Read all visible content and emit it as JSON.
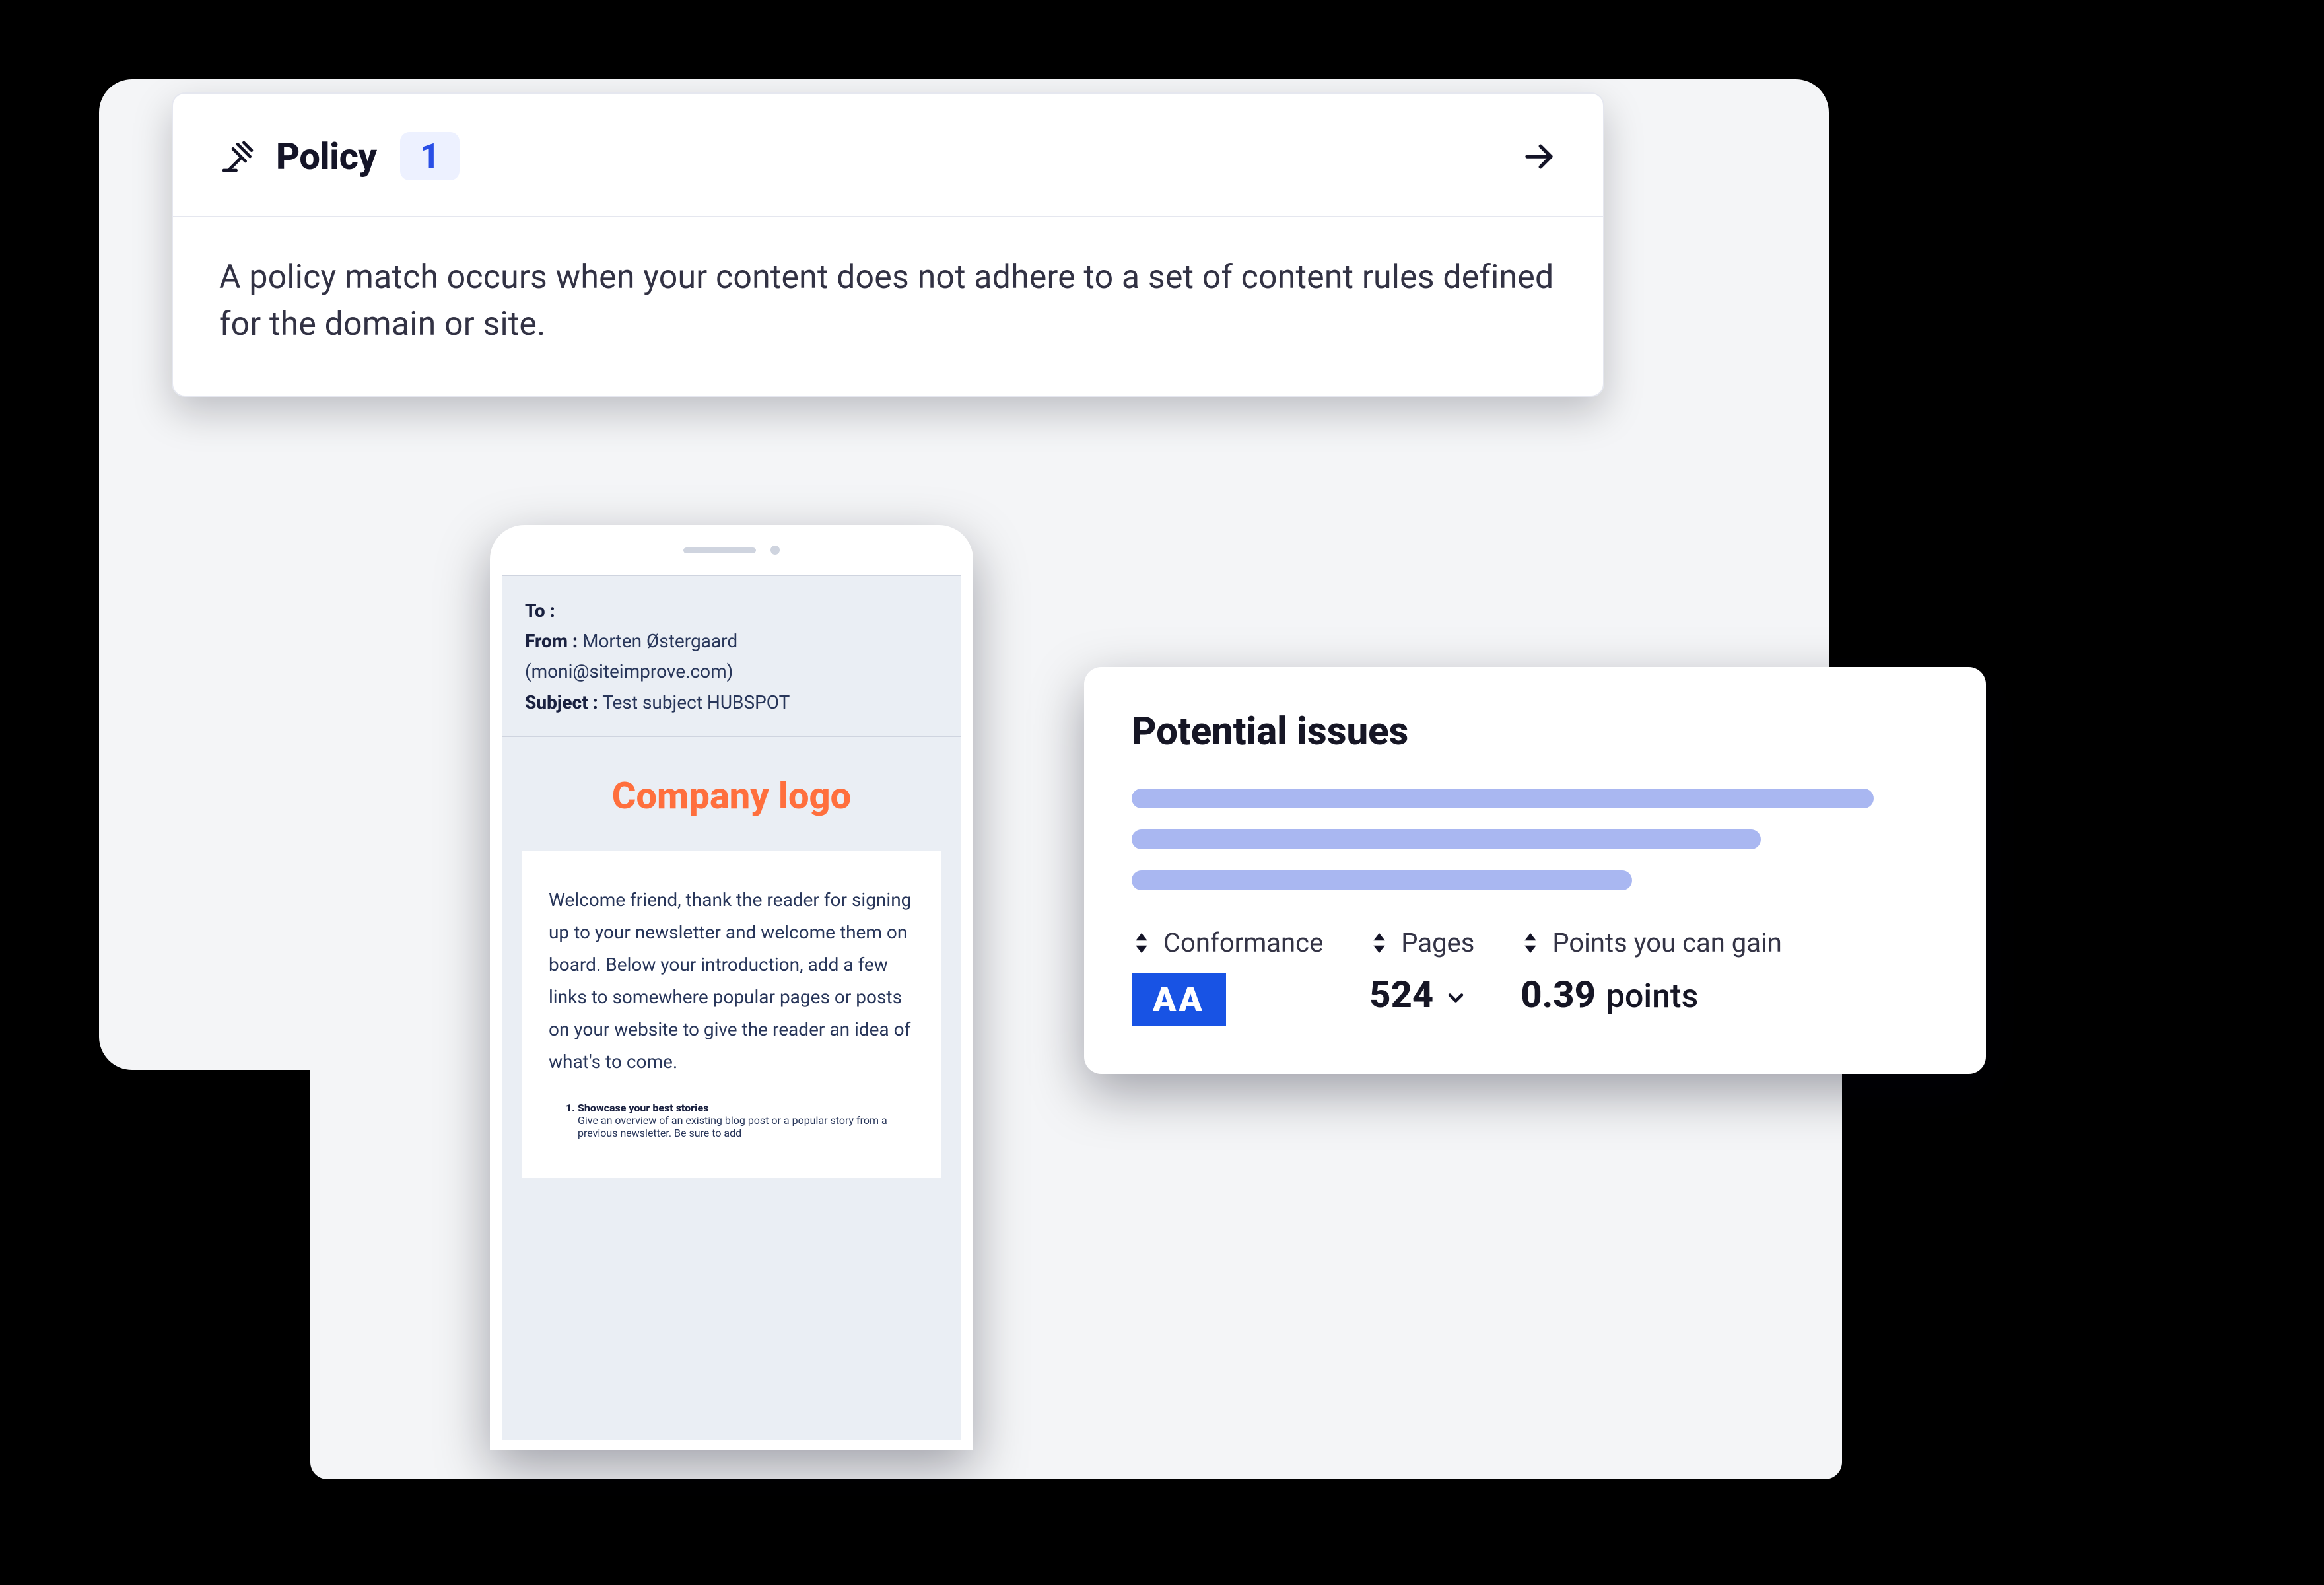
{
  "policy": {
    "title": "Policy",
    "count": "1",
    "description": "A policy match occurs when your content does not adhere to a set of content rules defined for the domain or site."
  },
  "phone": {
    "to_label": "To :",
    "to_value": "",
    "from_label": "From :",
    "from_name": "Morten Østergaard",
    "from_email": "(moni@siteimprove.com)",
    "subject_label": "Subject :",
    "subject_value": "Test subject HUBSPOT",
    "company_logo": "Company logo",
    "intro": "Welcome friend, thank the reader for signing up to your newsletter and welcome them on board. Below your introduction, add a few links to somewhere popular pages or posts on your website to give the reader an idea of what's to come.",
    "list": [
      {
        "title": "Showcase your best stories",
        "text": "Give an overview of an existing blog post or a popular story from a previous newsletter. Be sure to add"
      }
    ]
  },
  "issues": {
    "title": "Potential issues",
    "metrics": {
      "conformance": {
        "label": "Conformance",
        "value": "AA"
      },
      "pages": {
        "label": "Pages",
        "value": "524"
      },
      "points": {
        "label": "Points you can gain",
        "value": "0.39",
        "unit": "points"
      }
    }
  },
  "colors": {
    "accent_blue": "#1853e4",
    "soft_blue": "#a9b7f1",
    "orange": "#ff6f3d"
  }
}
